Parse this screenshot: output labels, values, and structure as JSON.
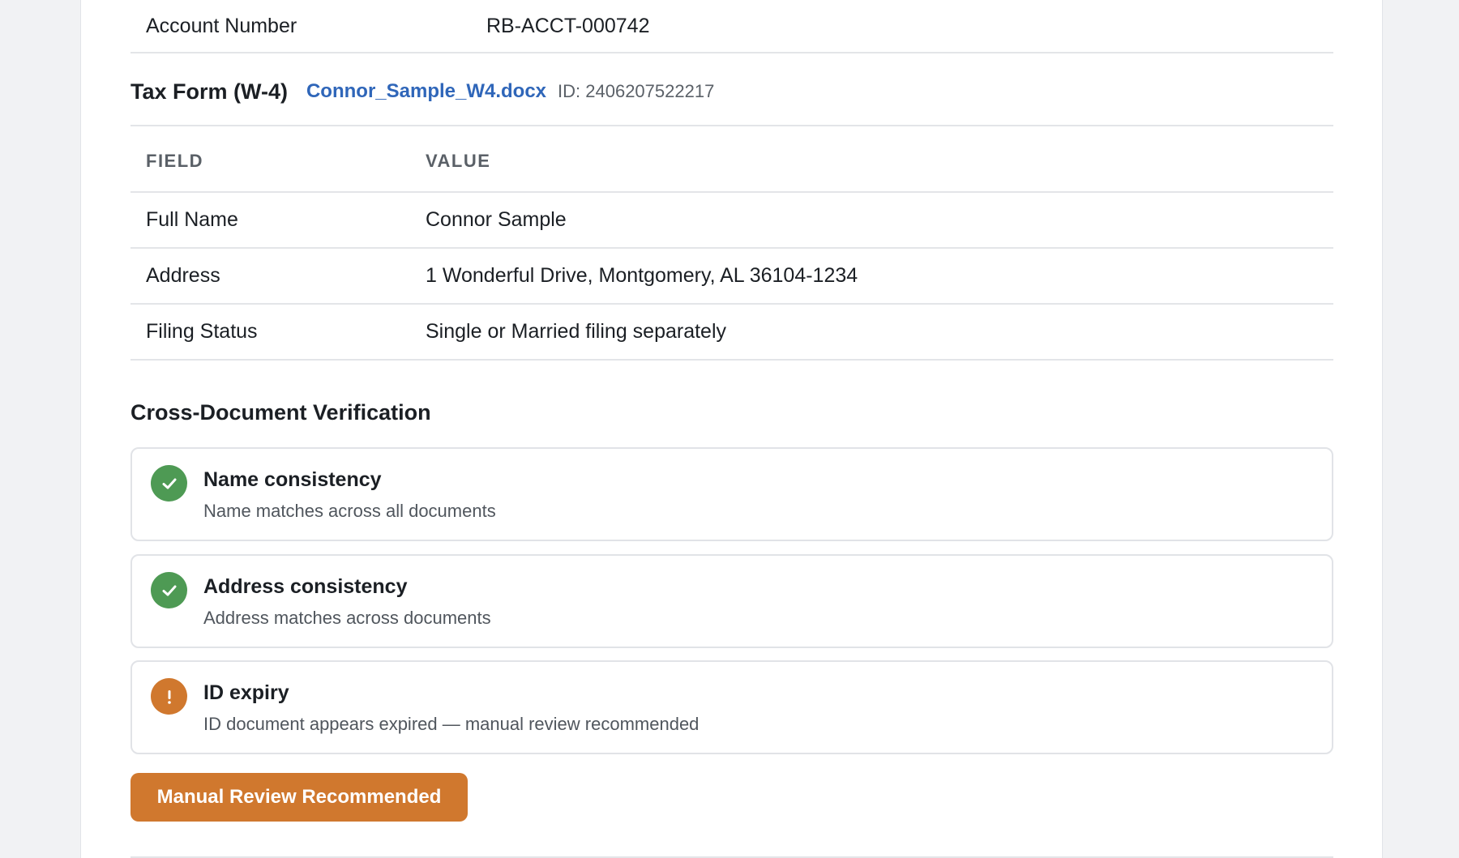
{
  "account": {
    "label": "Account Number",
    "value": "RB-ACCT-000742"
  },
  "tax_form": {
    "title": "Tax Form (W-4)",
    "file_name": "Connor_Sample_W4.docx",
    "id_text": "ID: 2406207522217",
    "columns": [
      "FIELD",
      "VALUE"
    ],
    "rows": [
      {
        "field": "Full Name",
        "value": "Connor Sample"
      },
      {
        "field": "Address",
        "value": "1 Wonderful Drive, Montgomery, AL 36104-1234"
      },
      {
        "field": "Filing Status",
        "value": "Single or Married filing separately"
      }
    ]
  },
  "verification": {
    "title": "Cross-Document Verification",
    "checks": [
      {
        "status": "pass",
        "icon": "check-icon",
        "title": "Name consistency",
        "detail": "Name matches across all documents"
      },
      {
        "status": "pass",
        "icon": "check-icon",
        "title": "Address consistency",
        "detail": "Address matches across documents"
      },
      {
        "status": "warning",
        "icon": "exclamation-icon",
        "title": "ID expiry",
        "detail": "ID document appears expired — manual review recommended"
      }
    ]
  },
  "action_button": {
    "label": "Manual Review Recommended"
  },
  "colors": {
    "success": "#4e9a54",
    "warning": "#d0782e",
    "link": "#2f66b9"
  }
}
